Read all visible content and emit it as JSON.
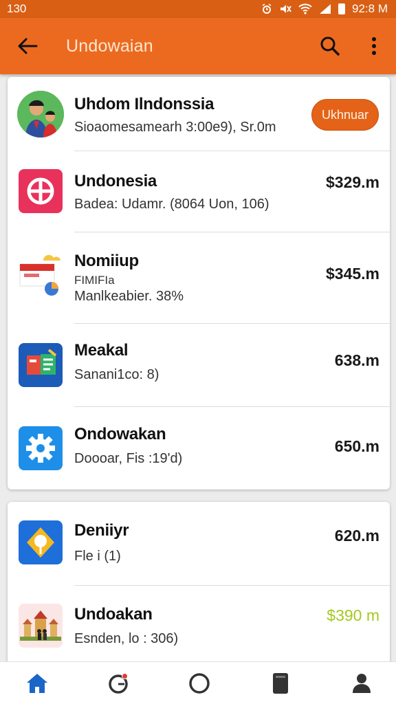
{
  "status_bar": {
    "time_left": "130",
    "time_right": "92:8 M"
  },
  "app_bar": {
    "title": "Undowaian"
  },
  "profile": {
    "name": "Uhdom Ilndonssia",
    "subtitle": "Sioaomesamearh 3:00e9), Sr.0m",
    "follow_label": "Ukhnuar"
  },
  "items": [
    {
      "title": "Undonesia",
      "subtitle": "Badea: Udamr. (8064 Uon, 106)",
      "amount": "$329.m",
      "icon": "circle-cross-icon"
    },
    {
      "title": "Nomiiup",
      "subtitle_line1": "FIMIFIa",
      "subtitle_line2": "Manlkeabier. 38%",
      "amount": "$345.m",
      "icon": "flag-card-icon"
    },
    {
      "title": "Meakal",
      "subtitle": "Sanani1co: 8)",
      "amount": "638.m",
      "icon": "form-icon"
    },
    {
      "title": "Ondowakan",
      "subtitle": "Doooar, Fis    :19'd)",
      "amount": "650.m",
      "icon": "gear-icon"
    },
    {
      "title": "Deniiyr",
      "subtitle": "Fle i (1)",
      "amount": "620.m",
      "icon": "location-pin-icon"
    },
    {
      "title": "Undoakan",
      "subtitle": "Esnden, lo : 306)",
      "amount": "$390 m",
      "icon": "temple-icon",
      "amount_color": "#a5c820"
    }
  ],
  "bottom_nav": [
    "home-icon",
    "notifications-icon",
    "circle-icon",
    "book-icon",
    "profile-icon"
  ],
  "colors": {
    "app_bar": "#ec6a1f",
    "status_bar": "#d95f14",
    "accent_button": "#e46318",
    "home_active": "#1a66c8"
  }
}
